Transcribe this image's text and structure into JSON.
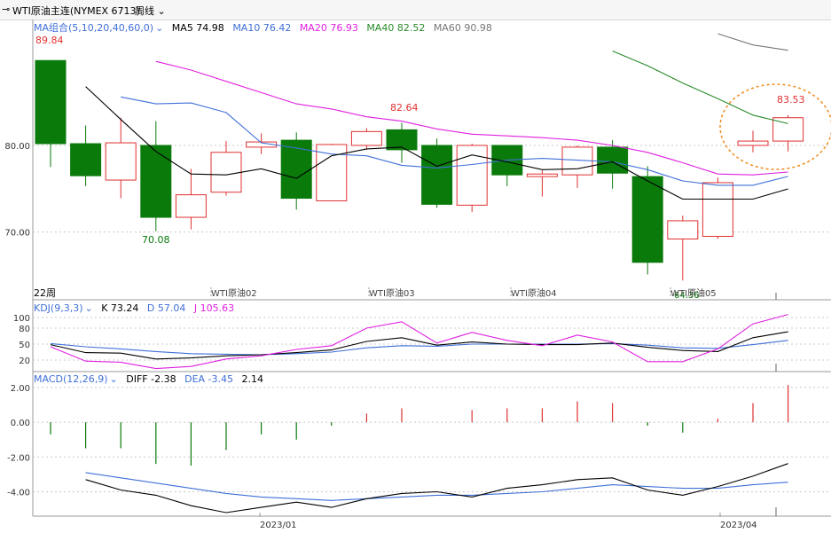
{
  "header": {
    "instrument": "WTI原油主连(NYMEX 6713)",
    "period": "周线",
    "icon": "arrow-icon"
  },
  "ma_legend": {
    "label": "MA组合(5,10,20,40,60,0)",
    "ma5": "MA5 74.98",
    "ma10": "MA10 76.42",
    "ma20": "MA20 76.93",
    "ma40": "MA40 82.52",
    "ma60": "MA60 90.98",
    "colors": {
      "ma5": "#000000",
      "ma10": "#3f6fd8",
      "ma20": "#e020e0",
      "ma40": "#2a8a2a",
      "ma60": "#777777"
    }
  },
  "kdj_legend": {
    "label": "KDJ(9,3,3)",
    "k": "K 73.24",
    "d": "D 57.04",
    "j": "J 105.63"
  },
  "macd_legend": {
    "label": "MACD(12,26,9)",
    "diff": "DIFF -2.38",
    "dea": "DEA -3.45",
    "macd": "2.14"
  },
  "markers": {
    "week_count": "22周",
    "high": "89.84",
    "low": "70.08",
    "mid_high": "82.64",
    "last": "83.53",
    "low2": "64.36"
  },
  "contract_labels": [
    "WTI原油02",
    "WTI原油03",
    "WTI原油04",
    "WTI原油05"
  ],
  "date_labels": [
    "2023/01",
    "2023/04"
  ],
  "chart_data": {
    "type": "candlestick",
    "colors": {
      "up": "#e03030",
      "down": "#0a7a0a"
    },
    "main_ylim": [
      63,
      93
    ],
    "main_yticks": [
      {
        "v": 80,
        "label": "80.00"
      },
      {
        "v": 70,
        "label": "70.00"
      }
    ],
    "candles": [
      {
        "o": 89.8,
        "h": 89.8,
        "l": 77.5,
        "c": 80.2
      },
      {
        "o": 80.2,
        "h": 82.3,
        "l": 75.3,
        "c": 76.5
      },
      {
        "o": 76.0,
        "h": 83.2,
        "l": 73.9,
        "c": 80.3
      },
      {
        "o": 80.0,
        "h": 82.8,
        "l": 70.1,
        "c": 71.7
      },
      {
        "o": 71.7,
        "h": 77.3,
        "l": 70.3,
        "c": 74.3
      },
      {
        "o": 74.6,
        "h": 80.5,
        "l": 74.2,
        "c": 79.2
      },
      {
        "o": 79.8,
        "h": 81.4,
        "l": 79.0,
        "c": 80.4
      },
      {
        "o": 80.6,
        "h": 81.5,
        "l": 72.6,
        "c": 73.9
      },
      {
        "o": 73.6,
        "h": 80.2,
        "l": 73.6,
        "c": 80.1
      },
      {
        "o": 80.0,
        "h": 82.0,
        "l": 79.5,
        "c": 81.6
      },
      {
        "o": 81.8,
        "h": 82.6,
        "l": 78.0,
        "c": 79.5
      },
      {
        "o": 80.0,
        "h": 80.8,
        "l": 72.8,
        "c": 73.2
      },
      {
        "o": 73.1,
        "h": 80.2,
        "l": 72.3,
        "c": 80.0
      },
      {
        "o": 80.0,
        "h": 80.0,
        "l": 75.3,
        "c": 76.6
      },
      {
        "o": 76.4,
        "h": 77.1,
        "l": 74.1,
        "c": 76.7
      },
      {
        "o": 76.6,
        "h": 80.0,
        "l": 75.1,
        "c": 79.8
      },
      {
        "o": 79.8,
        "h": 80.6,
        "l": 75.0,
        "c": 76.8
      },
      {
        "o": 76.4,
        "h": 77.6,
        "l": 65.1,
        "c": 66.5
      },
      {
        "o": 69.2,
        "h": 71.9,
        "l": 64.4,
        "c": 71.3
      },
      {
        "o": 69.5,
        "h": 76.3,
        "l": 69.2,
        "c": 75.7
      },
      {
        "o": 80.0,
        "h": 81.7,
        "l": 79.2,
        "c": 80.5
      },
      {
        "o": 80.5,
        "h": 83.5,
        "l": 79.3,
        "c": 83.2
      }
    ],
    "ma5": [
      86.8,
      83.0,
      79.3,
      76.7,
      76.6,
      77.3,
      76.2,
      78.8,
      79.6,
      79.8,
      77.6,
      78.9,
      78.1,
      77.2,
      77.3,
      78.1,
      75.9,
      73.8,
      73.8,
      73.8,
      74.98
    ],
    "ma10": [
      85.6,
      84.8,
      84.9,
      83.8,
      80.3,
      79.7,
      79.0,
      78.8,
      77.7,
      77.4,
      77.8,
      78.3,
      78.5,
      78.3,
      78.1,
      77.2,
      75.9,
      75.4,
      75.4,
      76.42
    ],
    "ma20": [
      89.7,
      88.7,
      87.4,
      86.1,
      84.8,
      84.2,
      83.3,
      82.8,
      81.9,
      81.3,
      81.1,
      80.9,
      80.6,
      80.0,
      79.2,
      78.0,
      76.7,
      76.6,
      76.93
    ],
    "ma40": [
      90.9,
      89.2,
      87.2,
      85.4,
      83.5,
      82.52
    ],
    "ma60": [
      92.9,
      91.6,
      90.98
    ],
    "kdj_ylim": [
      0,
      110
    ],
    "kdj_yticks": [
      100,
      80,
      50,
      20
    ],
    "k": [
      49,
      34,
      33,
      22,
      24,
      28,
      30,
      34,
      39,
      55,
      62,
      48,
      54,
      50,
      49,
      49,
      52,
      44,
      38,
      36,
      62,
      73.24
    ],
    "d": [
      51,
      45,
      41,
      36,
      32,
      31,
      30,
      32,
      35,
      43,
      47,
      46,
      50,
      50,
      50,
      50,
      51,
      48,
      43,
      42,
      49,
      57.04
    ],
    "j": [
      45,
      18,
      16,
      4,
      8,
      22,
      28,
      40,
      47,
      80,
      92,
      52,
      72,
      57,
      47,
      67,
      54,
      17,
      17,
      41,
      88,
      105.63
    ],
    "macd_ylim": [
      -5.2,
      2.2
    ],
    "macd_yticks": [
      {
        "v": 2,
        "label": "2.00"
      },
      {
        "v": 0,
        "label": "0.00"
      },
      {
        "v": -2,
        "label": "-2.00"
      },
      {
        "v": -4,
        "label": "-4.00"
      }
    ],
    "diff": [
      -3.3,
      -3.9,
      -4.2,
      -4.8,
      -5.2,
      -4.9,
      -4.6,
      -4.9,
      -4.4,
      -4.1,
      -4.0,
      -4.3,
      -3.8,
      -3.6,
      -3.3,
      -3.2,
      -3.9,
      -4.2,
      -3.7,
      -3.1,
      -2.38
    ],
    "dea": [
      -2.9,
      -3.2,
      -3.5,
      -3.8,
      -4.1,
      -4.3,
      -4.4,
      -4.5,
      -4.4,
      -4.3,
      -4.2,
      -4.2,
      -4.1,
      -4.0,
      -3.8,
      -3.6,
      -3.7,
      -3.8,
      -3.8,
      -3.6,
      -3.45
    ],
    "macd": [
      -0.7,
      -1.5,
      -1.5,
      -2.4,
      -2.5,
      -1.6,
      -0.7,
      -1.0,
      -0.2,
      0.5,
      0.8,
      0.0,
      0.7,
      0.8,
      0.8,
      1.2,
      1.1,
      -0.2,
      -0.6,
      0.2,
      1.1,
      2.14
    ]
  }
}
